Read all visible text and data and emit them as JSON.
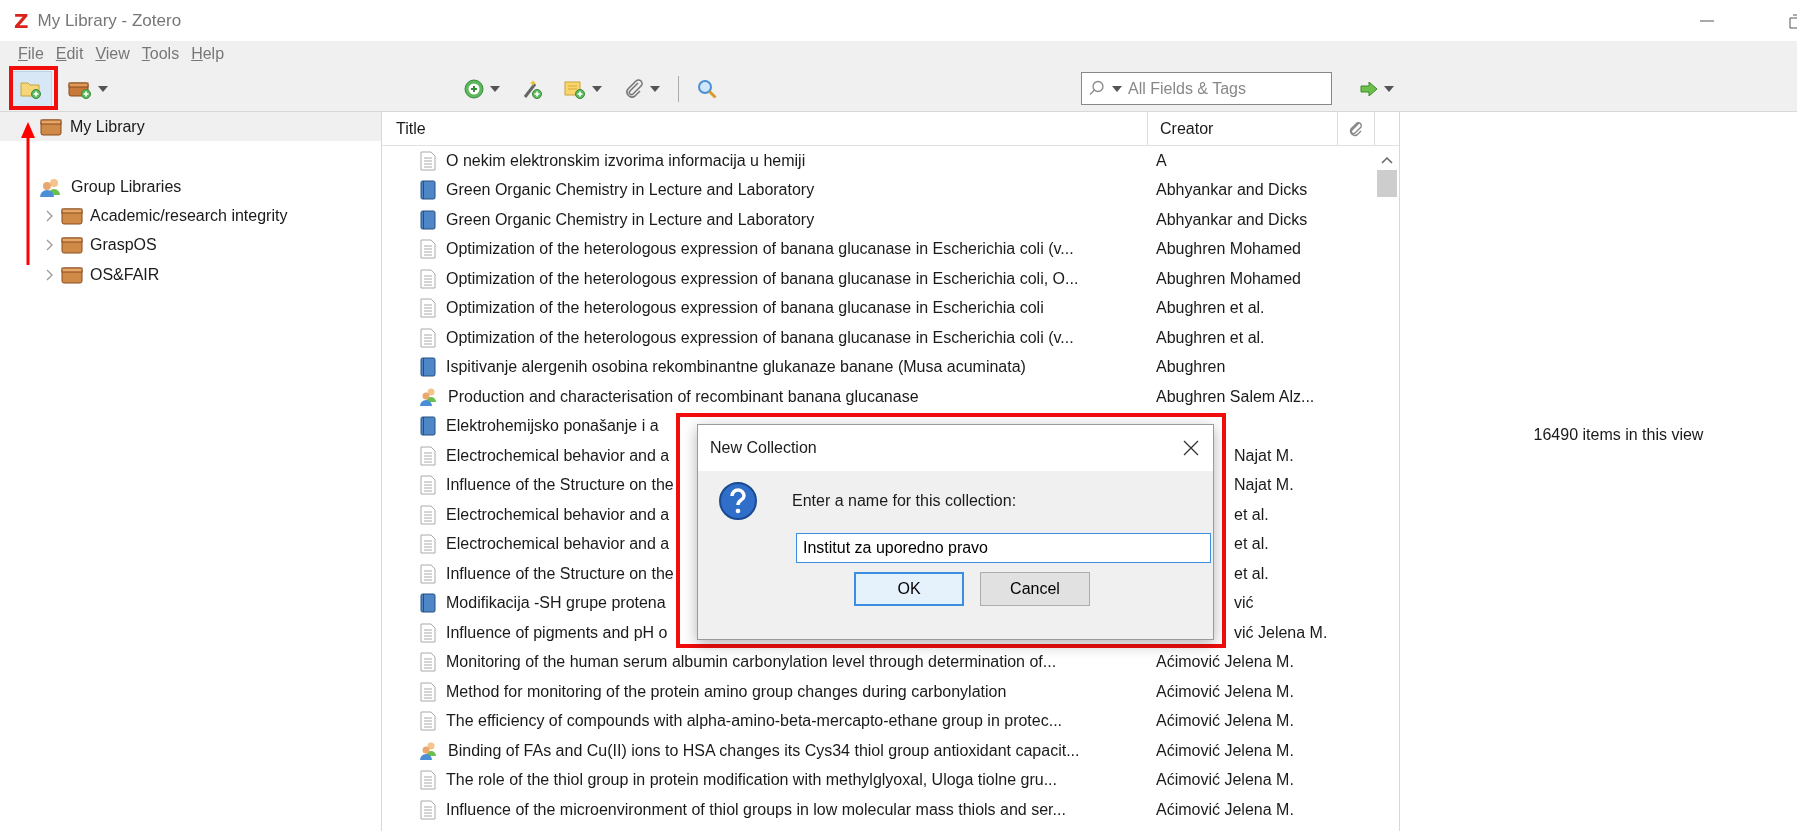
{
  "window": {
    "logo": "Z",
    "title": "My Library - Zotero"
  },
  "menu": [
    "File",
    "Edit",
    "View",
    "Tools",
    "Help"
  ],
  "toolbar": {
    "new_collection": {
      "highlighted": true
    },
    "search": {
      "placeholder": "All Fields & Tags"
    }
  },
  "collections": {
    "my_library": {
      "label": "My Library",
      "selected": true
    },
    "group_header": "Group Libraries",
    "groups": [
      {
        "label": "Academic/research integrity",
        "expanded": false
      },
      {
        "label": "GraspOS",
        "expanded": false
      },
      {
        "label": "OS&FAIR",
        "expanded": false
      }
    ]
  },
  "items": {
    "columns": [
      "Title",
      "Creator"
    ],
    "rows": [
      {
        "kind": "document",
        "title": "O nekim elektronskim izvorima informacija u hemiji",
        "creator": "A"
      },
      {
        "kind": "book",
        "title": "Green Organic Chemistry in Lecture and Laboratory",
        "creator": "Abhyankar and Dicks"
      },
      {
        "kind": "book",
        "title": "Green Organic Chemistry in Lecture and Laboratory",
        "creator": "Abhyankar and Dicks"
      },
      {
        "kind": "document",
        "title": "Optimization of the heterologous expression of banana glucanase in Escherichia coli (v...",
        "creator": "Abughren Mohamed"
      },
      {
        "kind": "document",
        "title": "Optimization of the heterologous expression of banana glucanase in Escherichia coli, O...",
        "creator": "Abughren Mohamed"
      },
      {
        "kind": "document",
        "title": "Optimization of the heterologous expression of banana glucanase in Escherichia coli",
        "creator": "Abughren et al."
      },
      {
        "kind": "document",
        "title": "Optimization of the heterologous expression of banana glucanase in Escherichia coli (v...",
        "creator": "Abughren et al."
      },
      {
        "kind": "book",
        "title": "Ispitivanje alergenih osobina rekombinantne glukanaze banane (Musa acuminata)",
        "creator": "Abughren"
      },
      {
        "kind": "people",
        "title": "Production and characterisation of recombinant banana glucanase",
        "creator": "Abughren Salem Alz..."
      },
      {
        "kind": "book",
        "title": "Elektrohemijsko ponašanje i a"
      },
      {
        "kind": "document",
        "title": "Electrochemical behavior and a",
        "creator": "Najat M.",
        "creator_cut": true
      },
      {
        "kind": "document",
        "title": "Influence of the Structure on the",
        "creator": "Najat M.",
        "creator_cut": true
      },
      {
        "kind": "document",
        "title": "Electrochemical behavior and a",
        "creator": "et al.",
        "creator_cut": true
      },
      {
        "kind": "document",
        "title": "Electrochemical behavior and a",
        "creator": "et al.",
        "creator_cut": true
      },
      {
        "kind": "document",
        "title": "Influence of the Structure on the",
        "creator": "et al.",
        "creator_cut": true
      },
      {
        "kind": "book",
        "title": "Modifikacija -SH grupe protena",
        "creator": "vić",
        "creator_cut": true
      },
      {
        "kind": "document",
        "title": "Influence of pigments and pH o",
        "creator": "vić Jelena M.",
        "creator_cut": true
      },
      {
        "kind": "document",
        "title": "Monitoring of the human serum albumin carbonylation level through determination of...",
        "creator": "Aćimović Jelena M."
      },
      {
        "kind": "document",
        "title": "Method for monitoring of the protein amino group changes during carbonylation",
        "creator": "Aćimović Jelena M."
      },
      {
        "kind": "document",
        "title": "The efficiency of compounds with alpha-amino-beta-mercapto-ethane group in protec...",
        "creator": "Aćimović Jelena M."
      },
      {
        "kind": "people",
        "title": "Binding of FAs and Cu(II) ions to HSA changes its Cys34 thiol group antioxidant capacit...",
        "creator": "Aćimović Jelena M."
      },
      {
        "kind": "document",
        "title": "The role of the thiol group in protein modification with methylglyoxal, Uloga tiolne gru...",
        "creator": "Aćimović Jelena M."
      },
      {
        "kind": "document",
        "title": "Influence of the microenvironment of thiol groups in low molecular mass thiols and ser...",
        "creator": "Aćimović Jelena M."
      }
    ]
  },
  "item_pane": {
    "count": "16490 items in this view"
  },
  "dialog": {
    "title": "New Collection",
    "prompt": "Enter a name for this collection:",
    "value": "Institut za uporedno pravo",
    "buttons": [
      {
        "label": "OK",
        "default": true
      },
      {
        "label": "Cancel",
        "default": false
      }
    ]
  }
}
